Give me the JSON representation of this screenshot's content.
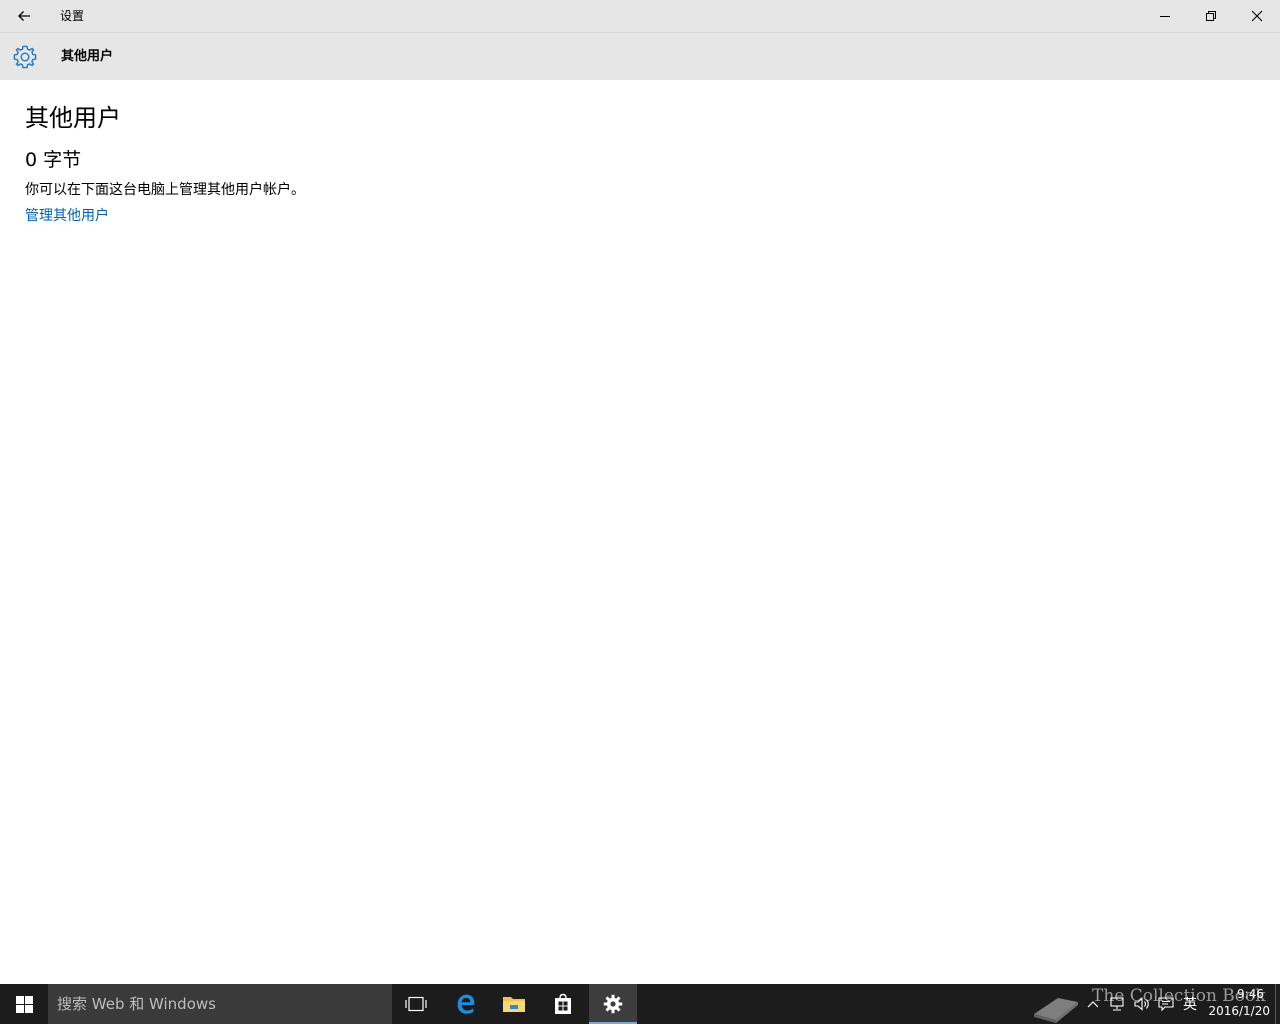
{
  "window": {
    "title": "设置"
  },
  "header": {
    "title": "其他用户"
  },
  "main": {
    "page_title": "其他用户",
    "size": "0 字节",
    "description": "你可以在下面这台电脑上管理其他用户帐户。",
    "manage_link": "管理其他用户"
  },
  "taskbar": {
    "search_placeholder": "搜索 Web 和 Windows",
    "pinned": [
      "task-view-icon",
      "edge-icon",
      "file-explorer-icon",
      "store-icon",
      "settings-icon"
    ],
    "active": "settings-icon",
    "watermark": "The Collection Book",
    "ime": "英",
    "time": "9:46",
    "date": "2016/1/20"
  },
  "colors": {
    "titlebar_bg": "#e6e6e6",
    "accent": "#0063b1",
    "taskbar_bg": "#1c1c1c",
    "search_bg": "#3a3a3a"
  }
}
